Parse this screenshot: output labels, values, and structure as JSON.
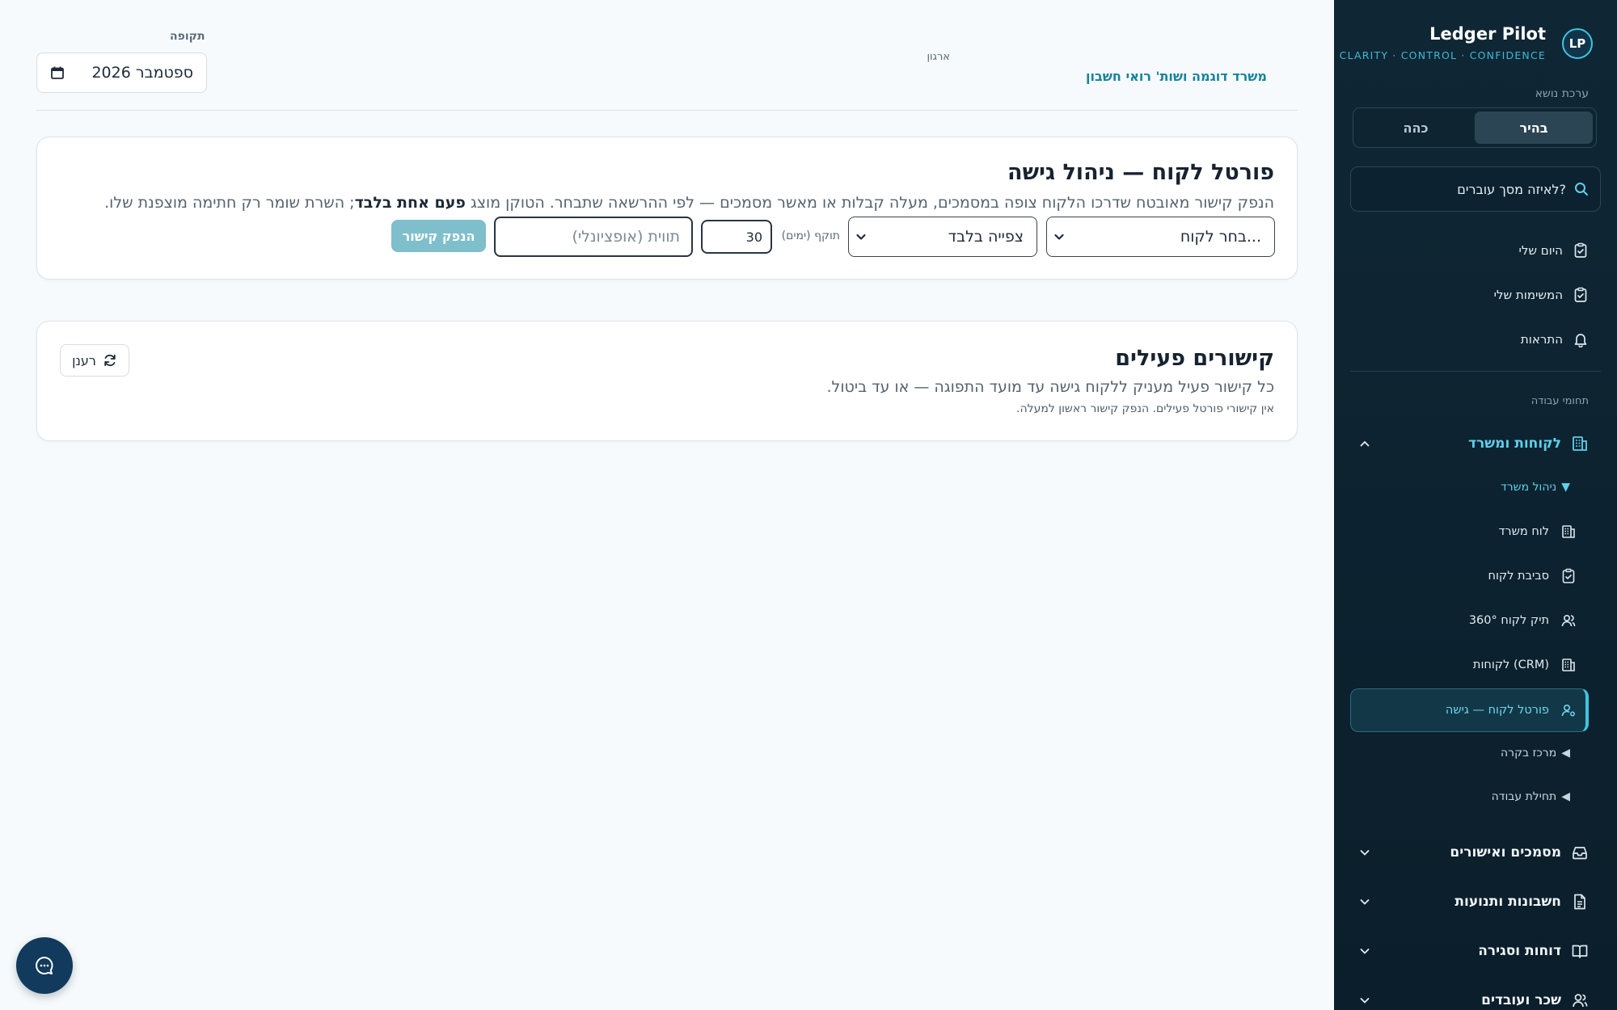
{
  "brand": {
    "logo_text": "LP",
    "name": "Ledger Pilot",
    "tagline": "CLARITY · CONTROL · CONFIDENCE"
  },
  "theme": {
    "label": "ערכת נושא",
    "options": [
      "בהיר",
      "כהה"
    ],
    "selected": "בהיר"
  },
  "sidebar_search": {
    "text": "לאיזה מסך עוברים?"
  },
  "personal_nav": [
    {
      "label": "היום שלי",
      "icon": "clipboard-check-icon"
    },
    {
      "label": "המשימות שלי",
      "icon": "clipboard-check-icon"
    },
    {
      "label": "התראות",
      "icon": "bell-icon"
    }
  ],
  "workspaces_label": "תחומי עבודה",
  "groups": {
    "clients_office": {
      "label": "לקוחות ומשרד",
      "subsection_office": "ניהול משרד",
      "items": [
        "לוח משרד",
        "סביבת לקוח",
        "תיק לקוח 360°",
        "לקוחות (CRM)",
        "פורטל לקוח — גישה"
      ],
      "subsection_control": "מרכז בקרה",
      "subsection_start": "תחילת עבודה"
    },
    "documents": "מסמכים ואישורים",
    "accounts": "חשבונות ותנועות",
    "reports": "דוחות וסגירה",
    "payroll": "שכר ועובדים"
  },
  "header": {
    "org_label": "ארגון",
    "org_value": "משרד דוגמה ושות' רואי חשבון",
    "period_label": "תקופה",
    "period_value": "ספטמבר 2026"
  },
  "portal_card": {
    "title": "פורטל לקוח — ניהול גישה",
    "desc_before": "הנפק קישור מאובטח שדרכו הלקוח צופה במסמכים, מעלה קבלות או מאשר מסמכים — לפי ההרשאה שתבחר. הטוקן מוצג ",
    "desc_bold": "פעם אחת בלבד",
    "desc_after": "; השרת שומר רק חתימה מוצפנת שלו.",
    "client_select": "בחר לקוח...",
    "permission_select": "צפייה בלבד",
    "days_label": "תוקף (ימים)",
    "days_value": "30",
    "label_placeholder": "תווית (אופציונלי)",
    "issue_button": "הנפק קישור"
  },
  "links_card": {
    "title": "קישורים פעילים",
    "desc": "כל קישור פעיל מעניק ללקוח גישה עד מועד התפוגה — או עד ביטול.",
    "empty": "אין קישורי פורטל פעילים. הנפק קישור ראשון למעלה.",
    "refresh_button": "רענן"
  },
  "colors": {
    "accent": "#3fc4e0",
    "sidebar_bg": "#0f2735",
    "org_text": "#16839b",
    "issue_button": "#7fbfcc"
  }
}
